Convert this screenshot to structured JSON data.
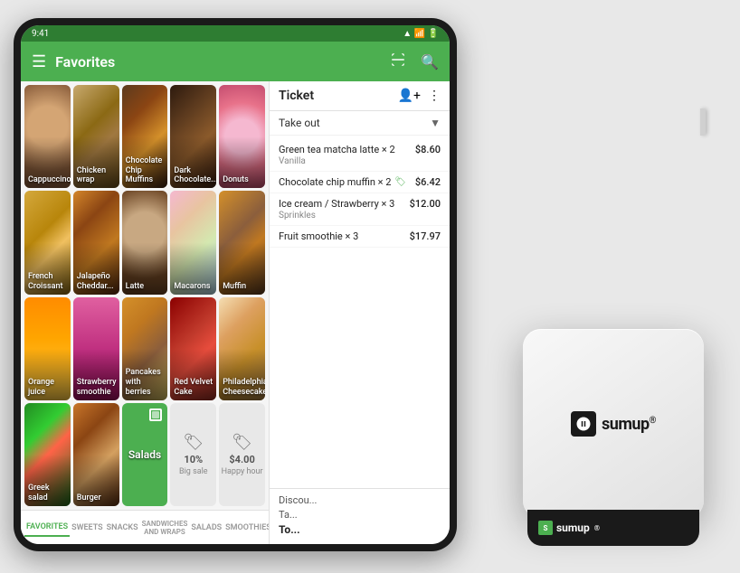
{
  "status_bar": {
    "time": "9:41",
    "wifi": "wifi",
    "battery": "battery"
  },
  "header": {
    "title": "Favorites",
    "menu_icon": "☰",
    "scan_icon": "⊞",
    "search_icon": "🔍"
  },
  "grid_items": [
    {
      "id": "cappuccino",
      "label": "Cappuccino",
      "img_class": "img-cappuccino",
      "type": "food"
    },
    {
      "id": "chicken-wrap",
      "label": "Chicken wrap",
      "img_class": "img-chicken-wrap",
      "type": "food"
    },
    {
      "id": "choc-muffins",
      "label": "Chocolate Chip Muffins",
      "img_class": "img-choc-muffin",
      "type": "food"
    },
    {
      "id": "dark-chocolate",
      "label": "Dark Chocolate...",
      "img_class": "img-dark-choc",
      "type": "food"
    },
    {
      "id": "donuts",
      "label": "Donuts",
      "img_class": "img-donuts",
      "type": "food"
    },
    {
      "id": "french-croissant",
      "label": "French Croissant",
      "img_class": "img-croissant",
      "type": "food"
    },
    {
      "id": "jalapeno",
      "label": "Jalapeño Cheddar...",
      "img_class": "img-jalapeno",
      "type": "food"
    },
    {
      "id": "latte",
      "label": "Latte",
      "img_class": "img-latte",
      "type": "food"
    },
    {
      "id": "macarons",
      "label": "Macarons",
      "img_class": "img-macarons",
      "type": "food"
    },
    {
      "id": "muffin",
      "label": "Muffin",
      "img_class": "img-muffin",
      "type": "food"
    },
    {
      "id": "orange-juice",
      "label": "Orange juice",
      "img_class": "img-orange-juice",
      "type": "food"
    },
    {
      "id": "strawberry-smoothie",
      "label": "Strawberry smoothie",
      "img_class": "img-smoothie",
      "type": "food"
    },
    {
      "id": "pancakes",
      "label": "Pancakes with berries",
      "img_class": "img-pancakes",
      "type": "food"
    },
    {
      "id": "red-velvet",
      "label": "Red Velvet Cake",
      "img_class": "img-red-velvet",
      "type": "food"
    },
    {
      "id": "philly",
      "label": "Philadelphia Cheesecake",
      "img_class": "img-philly",
      "type": "food"
    },
    {
      "id": "greek-salad",
      "label": "Greek salad",
      "img_class": "img-greek-salad",
      "type": "food"
    },
    {
      "id": "burger",
      "label": "Burger",
      "img_class": "img-burger2",
      "type": "food"
    },
    {
      "id": "salads",
      "label": "Salads",
      "img_class": "",
      "type": "green"
    },
    {
      "id": "big-sale",
      "label": "Big sale",
      "discount": "10%",
      "type": "discount"
    },
    {
      "id": "happy-hour",
      "label": "Happy hour",
      "discount": "$4.00",
      "type": "discount"
    }
  ],
  "tabs": [
    {
      "id": "favorites",
      "label": "FAVORITES",
      "active": true
    },
    {
      "id": "sweets",
      "label": "SWEETS",
      "active": false
    },
    {
      "id": "snacks",
      "label": "SNACKS",
      "active": false
    },
    {
      "id": "sandwiches",
      "label": "SANDWICHES AND WRAPS",
      "active": false
    },
    {
      "id": "salads",
      "label": "SALADS",
      "active": false
    },
    {
      "id": "smoothies",
      "label": "SMOOTHIES",
      "active": false
    }
  ],
  "ticket": {
    "title": "Ticket",
    "type": "Take out",
    "items": [
      {
        "name": "Green tea matcha latte × 2",
        "sub": "Vanilla",
        "price": "$8.60",
        "has_discount": false
      },
      {
        "name": "Chocolate chip muffin × 2",
        "sub": "",
        "price": "$6.42",
        "has_discount": true
      },
      {
        "name": "Ice cream / Strawberry × 3",
        "sub": "Sprinkles",
        "price": "$12.00",
        "has_discount": false
      },
      {
        "name": "Fruit smoothie × 3",
        "sub": "",
        "price": "$17.97",
        "has_discount": false
      }
    ],
    "discount_label": "Discou...",
    "tax_label": "Ta...",
    "total_label": "To..."
  },
  "sumup": {
    "logo_text": "sumup",
    "registered": "®",
    "bottom_text": "sumup"
  }
}
